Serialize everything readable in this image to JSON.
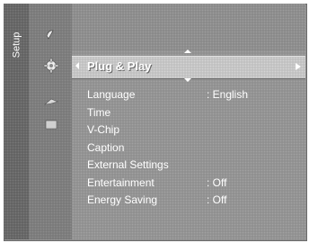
{
  "sidebar": {
    "title": "Setup"
  },
  "categories": [
    {
      "icon": "picture-icon"
    },
    {
      "icon": "setup-gear-icon"
    },
    {
      "icon": "sound-icon"
    },
    {
      "icon": "channel-icon"
    }
  ],
  "selected_item": {
    "label": "Plug & Play"
  },
  "menu": {
    "items": [
      {
        "label": "Language",
        "value": ": English"
      },
      {
        "label": "Time",
        "value": ""
      },
      {
        "label": "V-Chip",
        "value": ""
      },
      {
        "label": "Caption",
        "value": ""
      },
      {
        "label": "External Settings",
        "value": ""
      },
      {
        "label": "Entertainment",
        "value": ": Off"
      },
      {
        "label": "Energy Saving",
        "value": ": Off"
      }
    ]
  }
}
